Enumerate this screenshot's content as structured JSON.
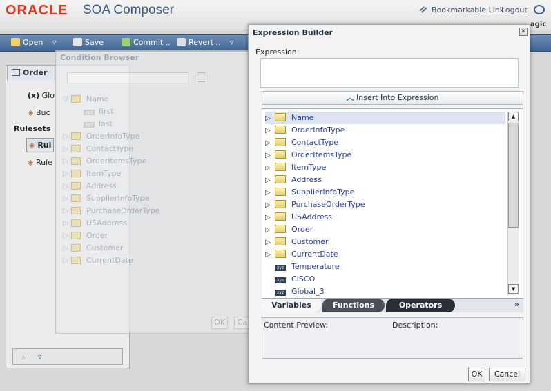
{
  "header": {
    "logo": "ORACLE",
    "app_title": "SOA Composer",
    "bookmark_link": "Bookmarkable Link",
    "logout_link": "Logout",
    "partial_text": "agic"
  },
  "toolbar": {
    "open": "Open",
    "save": "Save",
    "commit": "Commit ..",
    "revert": "Revert .."
  },
  "left_panel": {
    "tab_label": "Order",
    "item_globals": "Glo",
    "item_buckets": "Buc",
    "rulesets_label": "Rulesets",
    "ruleset_1": "Rul",
    "ruleset_2": "Rule"
  },
  "condition_browser": {
    "title": "Condition Browser",
    "tree": {
      "root": "Name",
      "first": "first",
      "last": "last",
      "items": [
        "OrderInfoType",
        "ContactType",
        "OrderItemsType",
        "ItemType",
        "Address",
        "SupplierInfoType",
        "PurchaseOrderType",
        "USAddress",
        "Order",
        "Customer",
        "CurrentDate"
      ]
    },
    "ok": "OK",
    "cancel": "Ca"
  },
  "expression_builder": {
    "title": "Expression Builder",
    "expression_label": "Expression:",
    "insert_button": "Insert Into Expression",
    "tree": [
      {
        "label": "Name",
        "type": "folder"
      },
      {
        "label": "OrderInfoType",
        "type": "folder"
      },
      {
        "label": "ContactType",
        "type": "folder"
      },
      {
        "label": "OrderItemsType",
        "type": "folder"
      },
      {
        "label": "ItemType",
        "type": "folder"
      },
      {
        "label": "Address",
        "type": "folder"
      },
      {
        "label": "SupplierInfoType",
        "type": "folder"
      },
      {
        "label": "PurchaseOrderType",
        "type": "folder"
      },
      {
        "label": "USAddress",
        "type": "folder"
      },
      {
        "label": "Order",
        "type": "folder"
      },
      {
        "label": "Customer",
        "type": "folder"
      },
      {
        "label": "CurrentDate",
        "type": "folder"
      },
      {
        "label": "Temperature",
        "type": "variable"
      },
      {
        "label": "CISCO",
        "type": "variable"
      },
      {
        "label": "Global_3",
        "type": "variable"
      }
    ],
    "tabs": {
      "variables": "Variables",
      "functions": "Functions",
      "operators": "Operators",
      "more": "»"
    },
    "content_preview_label": "Content Preview:",
    "description_label": "Description:",
    "ok": "OK",
    "cancel": "Cancel",
    "icon_badge": "xyz"
  }
}
